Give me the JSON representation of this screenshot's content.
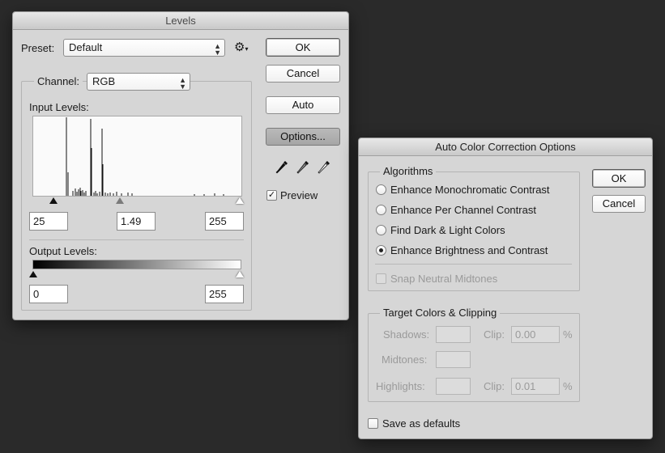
{
  "levels": {
    "title": "Levels",
    "preset_label": "Preset:",
    "preset_value": "Default",
    "preset_menu_icon": "gear-icon",
    "channel_label": "Channel:",
    "channel_value": "RGB",
    "input_levels_label": "Input Levels:",
    "input_black": "25",
    "input_gamma": "1.49",
    "input_white": "255",
    "output_levels_label": "Output Levels:",
    "output_black": "0",
    "output_white": "255",
    "buttons": {
      "ok": "OK",
      "cancel": "Cancel",
      "auto": "Auto",
      "options": "Options..."
    },
    "eyedroppers": [
      "black-point-eyedropper-icon",
      "gray-point-eyedropper-icon",
      "white-point-eyedropper-icon"
    ],
    "preview_label": "Preview",
    "preview_checked": true
  },
  "auto_color": {
    "title": "Auto Color Correction Options",
    "algorithms_title": "Algorithms",
    "algorithms": [
      {
        "label": "Enhance Monochromatic Contrast",
        "selected": false
      },
      {
        "label": "Enhance Per Channel Contrast",
        "selected": false
      },
      {
        "label": "Find Dark & Light Colors",
        "selected": false
      },
      {
        "label": "Enhance Brightness and Contrast",
        "selected": true
      }
    ],
    "snap_neutral_label": "Snap Neutral Midtones",
    "target_title": "Target Colors & Clipping",
    "shadows_label": "Shadows:",
    "midtones_label": "Midtones:",
    "highlights_label": "Highlights:",
    "clip_label": "Clip:",
    "shadows_clip": "0.00",
    "highlights_clip": "0.01",
    "percent": "%",
    "save_defaults_label": "Save as defaults",
    "buttons": {
      "ok": "OK",
      "cancel": "Cancel"
    }
  }
}
